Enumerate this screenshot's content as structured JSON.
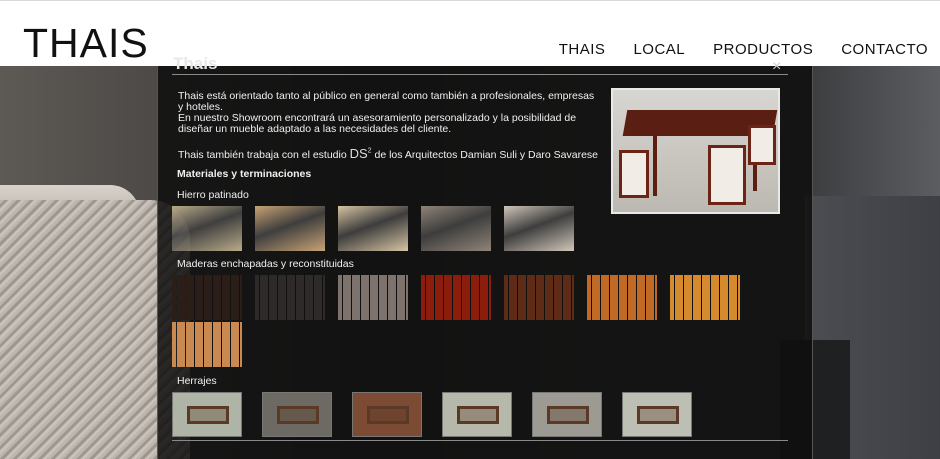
{
  "site": {
    "logo": "THAIS"
  },
  "nav": [
    {
      "label": "THAIS"
    },
    {
      "label": "LOCAL"
    },
    {
      "label": "PRODUCTOS"
    },
    {
      "label": "CONTACTO"
    }
  ],
  "panel": {
    "title": "Thais",
    "close_glyph": "×",
    "intro_line1": "Thais está orientado tanto al público en general como también a profesionales, empresas y hoteles.",
    "intro_line2": "En nuestro Showroom encontrará un asesoramiento personalizado y la posibilidad de diseñar un mueble adaptado a las necesidades del cliente.",
    "studio_prefix": "Thais también trabaja con el estudio ",
    "studio_logo": "DS",
    "studio_logo_sup": "2",
    "studio_suffix": " de los Arquitectos Damian Suli y Daro Savarese",
    "materials_heading": "Materiales y terminaciones",
    "sections": {
      "hierro": "Hierro patinado",
      "maderas": "Maderas enchapadas y reconstituidas",
      "herrajes": "Herrajes"
    }
  },
  "swatches": {
    "hierro": [
      "#b9ab8a",
      "#c8a374",
      "#d6c4a3",
      "#8f8478",
      "#cfc6b9"
    ],
    "maderas": [
      "#2b1d17",
      "#2e2a2a",
      "#7d726c",
      "#8c1d0c",
      "#5d2b16",
      "#c06a25",
      "#d58a2e",
      "#c98a52"
    ],
    "herrajes": [
      "#aeb5a6",
      "#6c6a62",
      "#7b4b33",
      "#b6b8a9",
      "#9c9a93",
      "#bdbfb4"
    ]
  },
  "colors": {
    "header_bg": "#ffffff",
    "panel_bg": "#0e0e0e"
  },
  "icons": {
    "close": "close-icon"
  }
}
